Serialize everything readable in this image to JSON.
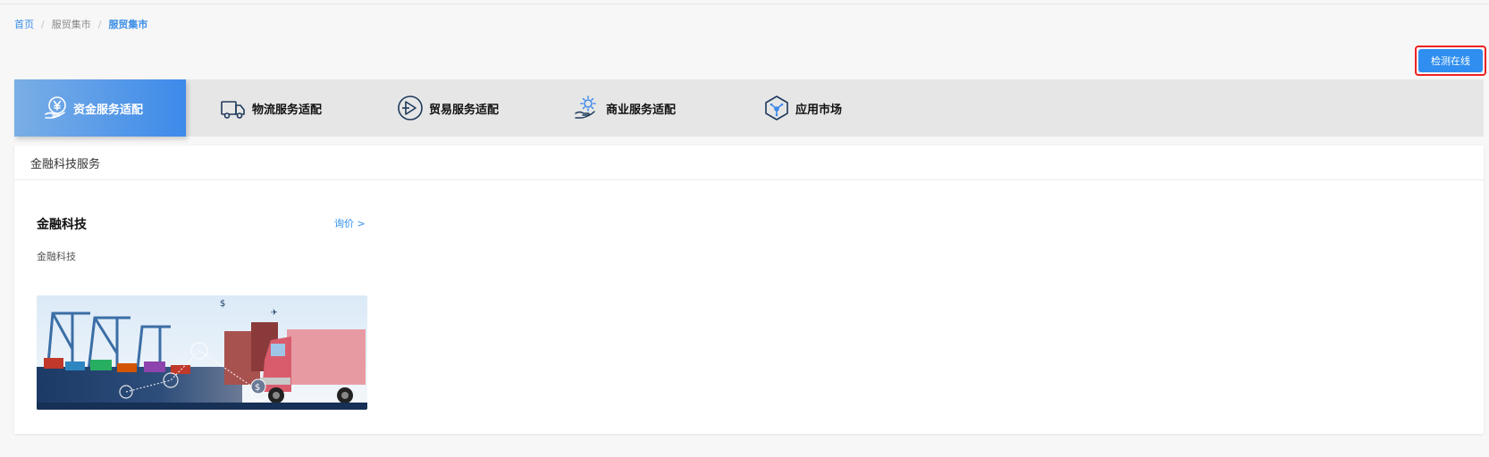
{
  "breadcrumb": {
    "home": "首页",
    "separator": "/",
    "level2": "服贸集市",
    "current": "服贸集市"
  },
  "toolbar": {
    "detect_label": "检测在线"
  },
  "tabs": [
    {
      "label": "资金服务适配",
      "icon": "yuan-hand-icon",
      "active": true
    },
    {
      "label": "物流服务适配",
      "icon": "truck-icon",
      "active": false
    },
    {
      "label": "贸易服务适配",
      "icon": "trade-icon",
      "active": false
    },
    {
      "label": "商业服务适配",
      "icon": "gear-hand-icon",
      "active": false
    },
    {
      "label": "应用市场",
      "icon": "cube-icon",
      "active": false
    }
  ],
  "section": {
    "title": "金融科技服务"
  },
  "card": {
    "title": "金融科技",
    "inquire_label": "询价 >",
    "description": "金融科技",
    "image": "logistics-port-truck-image"
  },
  "colors": {
    "accent": "#2f8ef0",
    "active_tab_start": "#7aaee6",
    "active_tab_end": "#3d8aea",
    "highlight_border": "#e22222",
    "tab_bar_bg": "#e6e6e6",
    "page_bg": "#f7f7f7"
  }
}
